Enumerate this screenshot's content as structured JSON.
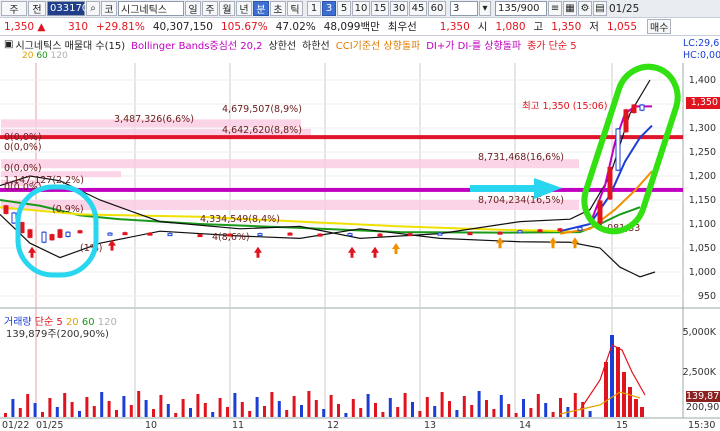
{
  "toolbar": {
    "menu_label": "주",
    "prev_label": "전",
    "code": "033170",
    "market_label": "코",
    "stock_name": "시그네틱스",
    "periods": [
      "일",
      "주",
      "월",
      "년",
      "분",
      "초",
      "틱"
    ],
    "selected_period": "분",
    "minute_options": [
      "1",
      "3",
      "5",
      "10",
      "15",
      "30",
      "45",
      "60"
    ],
    "selected_minute": "3",
    "interval_value": "3",
    "count_value": "135/900",
    "date_value": "01/25"
  },
  "quote": {
    "price": "1,350",
    "change": "310",
    "change_rate": "+29.81%",
    "volume": "40,307,150",
    "volume_ratio": "105.67%",
    "strength": "47.02%",
    "amount": "48,099백만",
    "tags": [
      "최우선",
      "1,350",
      "시",
      "1,080",
      "고",
      "1,350",
      "저",
      "1,055"
    ],
    "action": "매수"
  },
  "legend": {
    "items": [
      {
        "text": "시그네틱스 매물대 수(15)",
        "color": "#222222"
      },
      {
        "text": "Bollinger Bands중심선 20,2",
        "color": "#c000c0"
      },
      {
        "text": "상한선",
        "color": "#222222"
      },
      {
        "text": "하한선",
        "color": "#222222"
      },
      {
        "text": "CCI기준선 상향돌파",
        "color": "#e07a00"
      },
      {
        "text": "DI+가 DI-를 상향돌파",
        "color": "#c000c0"
      },
      {
        "text": "종가 단순 5",
        "color": "#e0141e"
      }
    ],
    "ma_items": [
      {
        "text": "20",
        "color": "#e0a000"
      },
      {
        "text": "60",
        "color": "#1a9a1a"
      },
      {
        "text": "120",
        "color": "#b0b0b0"
      }
    ],
    "right_labels": [
      "LC:29,6",
      "HC:0,00"
    ]
  },
  "price_axis": [
    "1,400",
    "1,350",
    "1,300",
    "1,250",
    "1,200",
    "1,150",
    "1,100",
    "1,050",
    "1,000",
    "950"
  ],
  "price_axis_values": [
    1400,
    1350,
    1300,
    1250,
    1200,
    1150,
    1100,
    1050,
    1000,
    950
  ],
  "volume_axis": [
    "5,000K",
    "2,500K"
  ],
  "volume_tags": [
    "139,87",
    "200,90"
  ],
  "current_price_tag": "1,350",
  "time_axis": [
    "01/22",
    "01/25",
    "10",
    "11",
    "12",
    "13",
    "14",
    "15",
    "15:30"
  ],
  "annotations": {
    "high": "최고 1,350 (15:06)",
    "volume_profile": [
      "4,679,507(8,9%)",
      "3,487,326(6,6%)",
      "4,642,620(8,8%)",
      "8,731,468(16,6%)",
      "8,704,234(16,5%)",
      "1,147,127(2,2%)",
      "0(0,0%)",
      "0(0,0%)",
      "0(0,0%)",
      "0(0,0%)",
      "1,081,33",
      "4,334,549(8,4%)",
      "(0,9%)",
      "(1%)",
      "4(8,6%)"
    ]
  },
  "volume_legend": {
    "title": "거래량",
    "items": [
      {
        "text": "단순 5",
        "color": "#e0141e"
      },
      {
        "text": "20",
        "color": "#e0a000"
      },
      {
        "text": "60",
        "color": "#1a9a1a"
      },
      {
        "text": "120",
        "color": "#b0b0b0"
      }
    ],
    "value": "139,879주(200,90%)"
  },
  "colors": {
    "up": "#e0141e",
    "down": "#1b3fd6",
    "boll_mid": "#c000c0",
    "highlight_cyan": "#29d6f0",
    "highlight_green": "#33e011"
  },
  "chart_data": {
    "type": "line",
    "title": "",
    "ylim": [
      950,
      1400
    ],
    "series": [
      {
        "name": "종가 단순 5",
        "values": [
          1120,
          1110,
          1090,
          1080,
          1075,
          1080,
          1090,
          1085,
          1082,
          1080,
          1082,
          1085,
          1080,
          1078,
          1080,
          1082,
          1085,
          1088,
          1090,
          1095,
          1098,
          1180,
          1280,
          1340,
          1340
        ]
      }
    ]
  }
}
